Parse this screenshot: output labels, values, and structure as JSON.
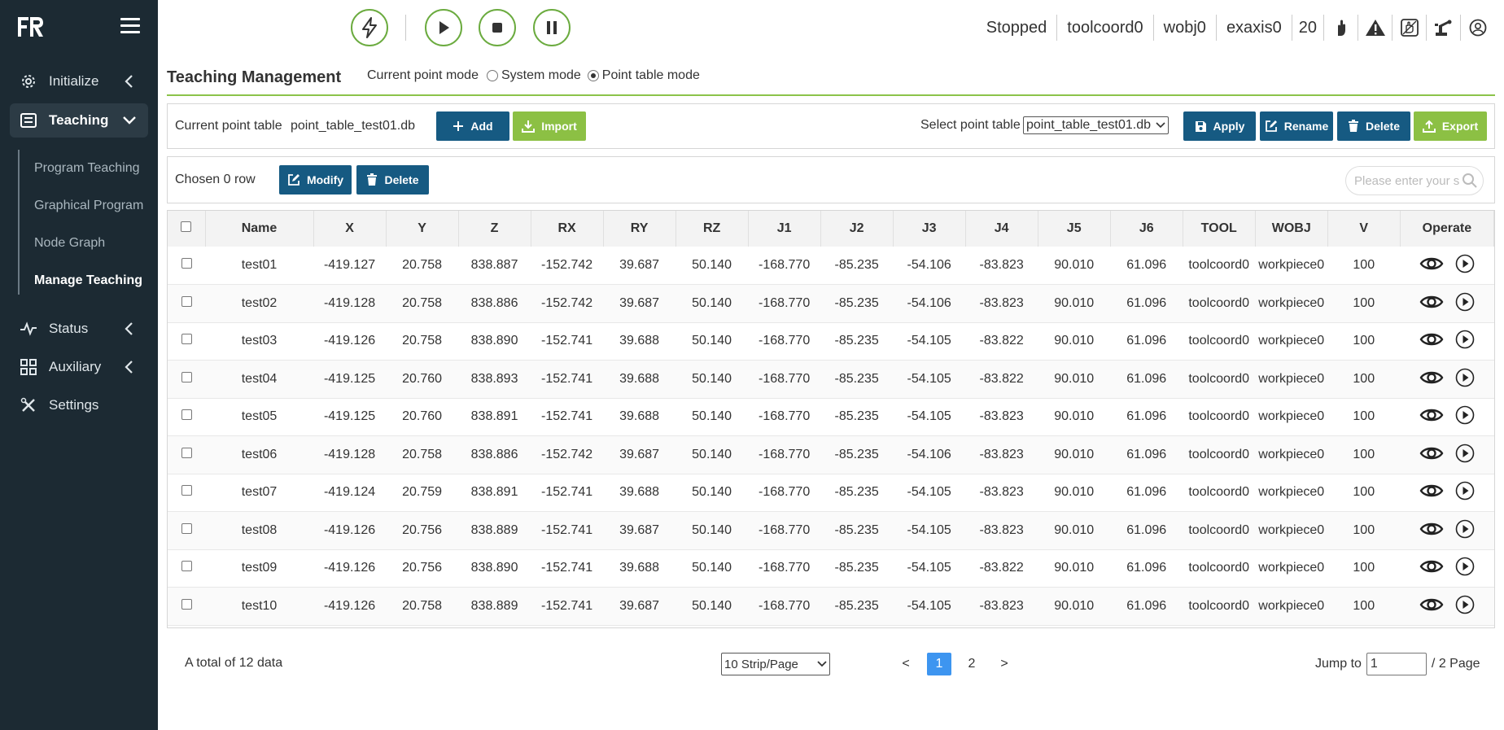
{
  "brand": {
    "logo": "FR"
  },
  "nav": {
    "items": [
      {
        "label": "Initialize",
        "icon": "gear-icon"
      },
      {
        "label": "Teaching",
        "icon": "list-icon"
      },
      {
        "label": "Status",
        "icon": "pulse-icon"
      },
      {
        "label": "Auxiliary",
        "icon": "grid-icon"
      },
      {
        "label": "Settings",
        "icon": "tools-icon"
      }
    ],
    "teaching_sub": [
      "Program Teaching",
      "Graphical Program",
      "Node Graph",
      "Manage Teaching"
    ]
  },
  "topbar": {
    "status": "Stopped",
    "tool": "toolcoord0",
    "wobj": "wobj0",
    "exaxis": "exaxis0",
    "speed": "20"
  },
  "header": {
    "title": "Teaching Management",
    "mode_label": "Current point mode",
    "mode_system": "System mode",
    "mode_table": "Point table mode",
    "mode_selected": "Point table mode"
  },
  "pointtable": {
    "current_label": "Current point table",
    "current_value": "point_table_test01.db",
    "add": "Add",
    "import": "Import",
    "select_label": "Select point table",
    "select_value": "point_table_test01.db",
    "apply": "Apply",
    "rename": "Rename",
    "delete": "Delete",
    "export": "Export"
  },
  "selection": {
    "chosen": "Chosen 0 row",
    "modify": "Modify",
    "delete": "Delete",
    "search_placeholder": "Please enter your s"
  },
  "table": {
    "headers": [
      "Name",
      "X",
      "Y",
      "Z",
      "RX",
      "RY",
      "RZ",
      "J1",
      "J2",
      "J3",
      "J4",
      "J5",
      "J6",
      "TOOL",
      "WOBJ",
      "V",
      "Operate"
    ],
    "rows": [
      [
        "test01",
        "-419.127",
        "20.758",
        "838.887",
        "-152.742",
        "39.687",
        "50.140",
        "-168.770",
        "-85.235",
        "-54.106",
        "-83.823",
        "90.010",
        "61.096",
        "toolcoord0",
        "workpiece0",
        "100"
      ],
      [
        "test02",
        "-419.128",
        "20.758",
        "838.886",
        "-152.742",
        "39.687",
        "50.140",
        "-168.770",
        "-85.235",
        "-54.106",
        "-83.823",
        "90.010",
        "61.096",
        "toolcoord0",
        "workpiece0",
        "100"
      ],
      [
        "test03",
        "-419.126",
        "20.758",
        "838.890",
        "-152.741",
        "39.688",
        "50.140",
        "-168.770",
        "-85.235",
        "-54.105",
        "-83.822",
        "90.010",
        "61.096",
        "toolcoord0",
        "workpiece0",
        "100"
      ],
      [
        "test04",
        "-419.125",
        "20.760",
        "838.893",
        "-152.741",
        "39.688",
        "50.140",
        "-168.770",
        "-85.235",
        "-54.105",
        "-83.822",
        "90.010",
        "61.096",
        "toolcoord0",
        "workpiece0",
        "100"
      ],
      [
        "test05",
        "-419.125",
        "20.760",
        "838.891",
        "-152.741",
        "39.688",
        "50.140",
        "-168.770",
        "-85.235",
        "-54.105",
        "-83.823",
        "90.010",
        "61.096",
        "toolcoord0",
        "workpiece0",
        "100"
      ],
      [
        "test06",
        "-419.128",
        "20.758",
        "838.886",
        "-152.742",
        "39.687",
        "50.140",
        "-168.770",
        "-85.235",
        "-54.106",
        "-83.823",
        "90.010",
        "61.096",
        "toolcoord0",
        "workpiece0",
        "100"
      ],
      [
        "test07",
        "-419.124",
        "20.759",
        "838.891",
        "-152.741",
        "39.688",
        "50.140",
        "-168.770",
        "-85.235",
        "-54.105",
        "-83.823",
        "90.010",
        "61.096",
        "toolcoord0",
        "workpiece0",
        "100"
      ],
      [
        "test08",
        "-419.126",
        "20.756",
        "838.889",
        "-152.741",
        "39.687",
        "50.140",
        "-168.770",
        "-85.235",
        "-54.105",
        "-83.823",
        "90.010",
        "61.096",
        "toolcoord0",
        "workpiece0",
        "100"
      ],
      [
        "test09",
        "-419.126",
        "20.756",
        "838.890",
        "-152.741",
        "39.688",
        "50.140",
        "-168.770",
        "-85.235",
        "-54.105",
        "-83.822",
        "90.010",
        "61.096",
        "toolcoord0",
        "workpiece0",
        "100"
      ],
      [
        "test10",
        "-419.126",
        "20.758",
        "838.889",
        "-152.741",
        "39.687",
        "50.140",
        "-168.770",
        "-85.235",
        "-54.105",
        "-83.823",
        "90.010",
        "61.096",
        "toolcoord0",
        "workpiece0",
        "100"
      ]
    ]
  },
  "pagination": {
    "total": "A total of 12 data",
    "per_page": "10 Strip/Page",
    "prev": "<",
    "pages": [
      "1",
      "2"
    ],
    "current": "1",
    "next": ">",
    "jump_label": "Jump to",
    "jump_value": "1",
    "page_total": "/ 2 Page"
  },
  "colors": {
    "sidebar": "#1c2a33",
    "accent_green": "#8cc044",
    "button_blue": "#165a82",
    "page_active": "#3d95f0"
  }
}
